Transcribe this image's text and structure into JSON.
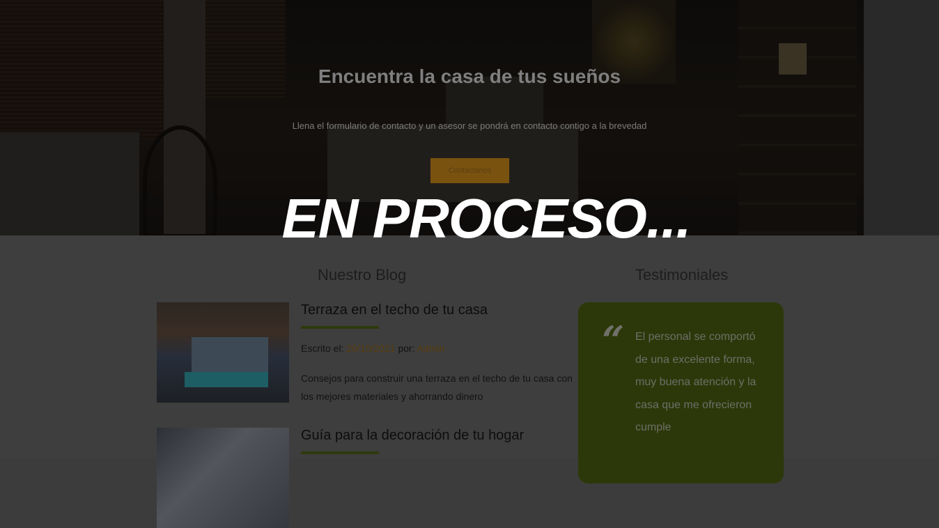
{
  "hero": {
    "title": "Encuentra la casa de tus sueños",
    "subtitle": "Llena el formulario de contacto y un asesor se pondrá en contacto contigo a la brevedad",
    "button_label": "Contactanos"
  },
  "overlay_text": "EN PROCESO...",
  "blog": {
    "section_title": "Nuestro Blog",
    "posts": [
      {
        "title": "Terraza en el techo de tu casa",
        "meta_prefix": "Escrito el: ",
        "date": "20/10/2021",
        "by_label": " por: ",
        "author": "Admin",
        "description": "Consejos para construir una terraza en el techo de tu casa con los mejores materiales y ahorrando dinero"
      },
      {
        "title": "Guía para la decoración de tu hogar"
      }
    ]
  },
  "testimonials": {
    "section_title": "Testimoniales",
    "quote_mark": "“",
    "text": "El personal se comportó de una excelente forma, muy buena atención y la casa que me ofrecieron cumple"
  },
  "colors": {
    "accent_orange": "#7a5210",
    "accent_green": "#2c3809"
  }
}
